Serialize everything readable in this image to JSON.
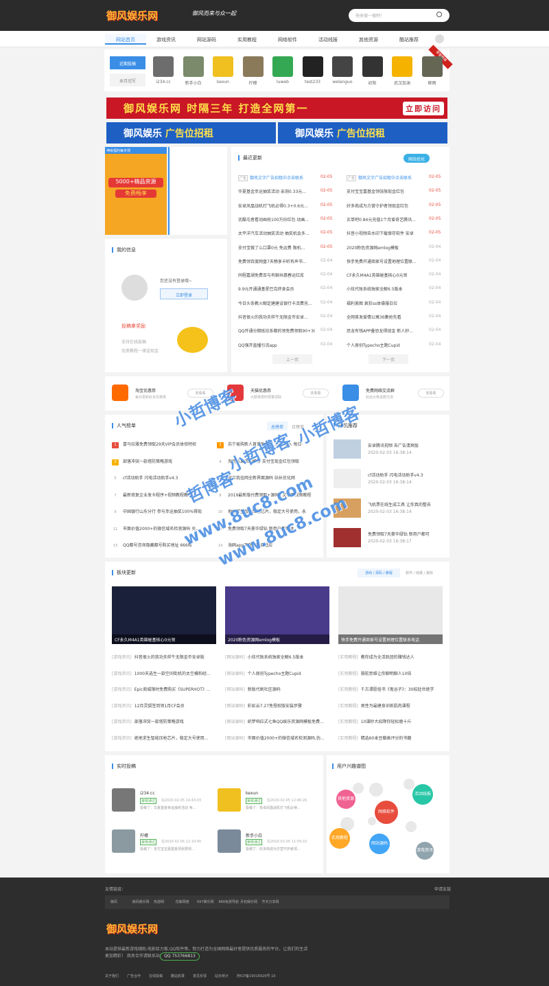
{
  "header": {
    "logo": "御风娱乐网",
    "slogan": "御风而来与众一起",
    "search_placeholder": "快来搜一搜吧！",
    "search_icon": "search-icon"
  },
  "nav": {
    "items": [
      "网站首页",
      "游戏资讯",
      "网站源码",
      "实用教程",
      "网络软件",
      "活动线报",
      "其他资源",
      "酷站推荐"
    ]
  },
  "contrib": {
    "tab_recent": "近期投稿",
    "tab_month": "本月冠军",
    "badge": "荣誉榜单",
    "users": [
      "i234.cc",
      "新手小白",
      "kexun",
      "柠檬",
      "luweb",
      "test233",
      "welanguo",
      "初阳",
      "武汉加油",
      "柳雨"
    ]
  },
  "banners": {
    "main": "御风娱乐网  时隔三年  打造全网第一",
    "main_btn": "立即访问",
    "ad1_a": "御风娱乐",
    "ad1_b": "广告位招租",
    "ad2_a": "御风娱乐",
    "ad2_b": "广告位招租"
  },
  "promo": {
    "top": "神级福利每天领",
    "big": "5000+精品资源",
    "sub": "免费畅享"
  },
  "myinfo": {
    "title": "我的信息",
    "not_logged": "您还没有登录哦~",
    "login_btn": "立即登录",
    "reward_title": "投稿拿奖励",
    "reward_l1": "支持在线投稿",
    "reward_l2": "优质教程一律送现金"
  },
  "news": {
    "title": "最近更新",
    "badge": "网站优化",
    "prev": "上一页",
    "next": "下一页",
    "left": [
      {
        "t": "御风文字广告招租中点击联系",
        "d": "02-05",
        "ad": true
      },
      {
        "t": "华夏基金幸运抽奖活动 亲测0.33元...",
        "d": "02-05"
      },
      {
        "t": "安卓凤凰战机打飞机必得0.3+0.6元...",
        "d": "02-05"
      },
      {
        "t": "优酷屯者看动画抢100万份红包 动画...",
        "d": "02-05"
      },
      {
        "t": "太平洋汽车活动抽奖活动 抽奖机会多...",
        "d": "02-05"
      },
      {
        "t": "支付宝做了么口罩0元 免运费 限机...",
        "d": "02-05"
      },
      {
        "t": "免费领百度网盘7天畅享卡听有声书...",
        "d": "02-04"
      },
      {
        "t": "同程嘉湖免费百与有聊共惠春运红库",
        "d": "02-04"
      },
      {
        "t": "9.9元开通通基星巴克终身会员",
        "d": "02-04"
      },
      {
        "t": "今日头条教火眼定建建设银行卡活费充...",
        "d": "02-04"
      },
      {
        "t": "抖音很火的我功夫样牛无限金币安卓...",
        "d": "02-04"
      },
      {
        "t": "QQ开通分期抵扣系都的领免费领取90+30...",
        "d": "02-04"
      },
      {
        "t": "QQ强开直播引流app",
        "d": "02-04"
      }
    ],
    "right": [
      {
        "t": "御风文字广告招租中点击联系",
        "d": "02-05",
        "ad": true
      },
      {
        "t": "支付宝宝嘉基金领张限现金红包",
        "d": "02-05"
      },
      {
        "t": "好多商成为方营守护者领现金红包",
        "d": "02-05"
      },
      {
        "t": "买单吧0.84元充值1个月爱奇艺腾讯...",
        "d": "02-05"
      },
      {
        "t": "抖音小视频去水印下载保存软件 安卓",
        "d": "02-05"
      },
      {
        "t": "2020粉色资源网emlog模板",
        "d": "02-04"
      },
      {
        "t": "快手免费开通商家号设置地理位置联...",
        "d": "02-04"
      },
      {
        "t": "CF永久M4A1英雄碰基核心0元领",
        "d": "02-04"
      },
      {
        "t": "小炫代账系统独家全解6.5版本",
        "d": "02-04"
      },
      {
        "t": "福利美图 疯狂ss体操服日拉",
        "d": "02-04"
      },
      {
        "t": "全网首发爱情公寓36集抢先看",
        "d": "02-04"
      },
      {
        "t": "恐龙有钱APP叠恐龙得现金 新人秒...",
        "d": "02-04"
      },
      {
        "t": "个人原创Typecho主题Cupid",
        "d": "02-04"
      }
    ]
  },
  "coupons": [
    {
      "title": "淘宝优惠券",
      "desc": "每日更新好多优惠券",
      "btn": "去看看"
    },
    {
      "title": "天猫优惠券",
      "desc": "大额券限时限量领取",
      "btn": "去看看"
    },
    {
      "title": "免费网络交流群",
      "desc": "欢迎大佬进群交流",
      "btn": "去看看"
    }
  ],
  "rank": {
    "title": "人气榜单",
    "tabs": [
      "总榜单"
    ],
    "tab_day": "日榜单",
    "left": [
      {
        "n": "1",
        "t": "喜马拉雅免费领取29天VIP会员体验特权"
      },
      {
        "n": "3",
        "t": "部落冲突一款塔防策略游戏"
      },
      {
        "n": "5",
        "t": "cf活动助手 闪电活动助手v4.3"
      },
      {
        "n": "7",
        "t": "最新修复企业发卡程序+视频教程教学"
      },
      {
        "n": "9",
        "t": "中国银行山东分行 参与幸运抽奖100%得现"
      },
      {
        "n": "11",
        "t": "市面价值2000+的微信域名检测源码 兑..."
      },
      {
        "n": "13",
        "t": "QQ都号咨询隐藏都号购买地址 666和"
      }
    ],
    "right": [
      {
        "n": "2",
        "t": "苏宁易购新人首单助力享...0元抽入 每日"
      },
      {
        "n": "4",
        "t": "淘宝水果活动推荐 支付宝现金红包领取"
      },
      {
        "n": "6",
        "t": "宜兰我挂网全新界面源码 站长优化网"
      },
      {
        "n": "8",
        "t": "2019最新版付费领取+源码+文字跟视频教程"
      },
      {
        "n": "10",
        "t": "地址求生智能压枪芯片，稳定大号使用，永"
      },
      {
        "n": "12",
        "t": "免费领取7天豪华绿钻 新用户都可领"
      },
      {
        "n": "14",
        "t": "海鸥app下载页面自适应"
      }
    ]
  },
  "random": {
    "title": "随机推荐",
    "items": [
      {
        "t": "安卓腾讯视频 去广告清爽版",
        "d": "2020-02-03 16:38:14"
      },
      {
        "t": "cf活动助手 闪电活动助手v4.3",
        "d": "2020-02-03 16:38:14"
      },
      {
        "t": "飞机票在线生成工具 让你真的整去",
        "d": "2020-02-03 16:38:14"
      },
      {
        "t": "免费领取7天豪华绿钻 新用户都可",
        "d": "2020-02-03 16:38:17"
      }
    ]
  },
  "blocks": {
    "title": "板块更新",
    "tabs": [
      "游戏 / 源码 / 教程",
      "软件 / 线报 / 其他"
    ],
    "cards": [
      "CF永久M4A1英雄碰基核心0元领",
      "2020粉色资源网emlog模板",
      "快手免费开通商家号设置地理位置联系电话"
    ],
    "col1": [
      [
        "[游戏资讯]",
        "抖音很火的我功夫样牛无限金币安卓版"
      ],
      [
        "[游戏资讯]",
        "1000天选生一款空间街机的太空横和经..."
      ],
      [
        "[游戏资讯]",
        "Epic商城限时免费购买《SUPERHOT》..."
      ],
      [
        "[游戏资讯]",
        "12月灵狐签到领1月CF会员"
      ],
      [
        "[游戏资讯]",
        "部落冲突一款塔防策略游戏"
      ],
      [
        "[游戏资讯]",
        "绝地求生智能压枪芯片，稳定大号使用..."
      ]
    ],
    "col2": [
      [
        "[网站源码]",
        "小炫代账系统独家全解6.5版本"
      ],
      [
        "[网站源码]",
        "个人原创Typecho主题Cupid"
      ],
      [
        "[网站源码]",
        "新版代刷社区源码"
      ],
      [
        "[网站源码]",
        "彩虹云7.27免授权版安装步骤"
      ],
      [
        "[网站源码]",
        "织梦响应式七鱼QQ娱乐资源网模板免费..."
      ],
      [
        "[网站源码]",
        "市面价值2000+的微信域名检测源码,伪..."
      ]
    ],
    "col3": [
      [
        "[实用教程]",
        "教你成为全活跃团的赚钱达人"
      ],
      [
        "[实用教程]",
        "骆驼思维让你聊明聊人10倍"
      ],
      [
        "[实用教程]",
        "千古谭愿俗书《鬼谷子》：30招处世绝学"
      ],
      [
        "[实用教程]",
        "男性为最健身训练肌肉课程"
      ],
      [
        "[实用教程]",
        "10课秒大招降你轻松瘦十斤"
      ],
      [
        "[实用教程]",
        "精选60本豆瓣高评分的书籍"
      ]
    ]
  },
  "realtime": {
    "title": "实时投稿",
    "items": [
      {
        "name": "i234.cc",
        "tag": "审核通过",
        "time": "在2020-02-05 14:43:03",
        "desc": "投稿了：华夏基金幸运抽奖活动 亲..."
      },
      {
        "name": "kexun",
        "tag": "审核通过",
        "time": "在2020-02-05 12:46:26",
        "desc": "投稿了：安卓凤凰战机打飞机必得..."
      },
      {
        "name": "柠檬",
        "tag": "审核通过",
        "time": "在2020-02-05 12:10:40",
        "desc": "投稿了：支付宝宝嘉基金领张限现..."
      },
      {
        "name": "新手小白",
        "tag": "审核通过",
        "time": "在2020-02-05 11:59:10",
        "desc": "投稿了：好多商成为方营守护者领..."
      }
    ]
  },
  "interest": {
    "title": "用户兴趣谱图",
    "labels": [
      "网络软件",
      "活动线报",
      "其他资源",
      "实用教程",
      "网站源码",
      "游戏资讯"
    ],
    "colors": [
      "#e74c3c",
      "#26c6a6",
      "#f06292",
      "#ffa726",
      "#42a5f5",
      "#90a4ae"
    ]
  },
  "footer": {
    "links_title": "友情链接：",
    "apply": "申请友链",
    "links": [
      "御风",
      "御风娱乐网",
      "热游网",
      "花蝶网络",
      "697娱乐网",
      "888免费导航",
      "月初娱乐网",
      "齐天分享网"
    ],
    "logo": "御风娱乐网",
    "desc": "本站提供最新游戏辅助,电影给力客,QQ软件等。努力打造为全国网络最好者提供优质服务的平台，让我们的生活更加精彩！ 商务合作请联系站长",
    "qq": "QQ 753766813",
    "bottom": [
      "关于我们",
      "广告合作",
      "在线投稿",
      "酷站收录",
      "意见反馈",
      "站长统计",
      "阿ICP备19016929号-10"
    ]
  },
  "watermark": [
    "小哲博客",
    "小哲博客",
    "小哲博客",
    "哲博客",
    "www.8uc8.com",
    "www.8uc8.com"
  ]
}
